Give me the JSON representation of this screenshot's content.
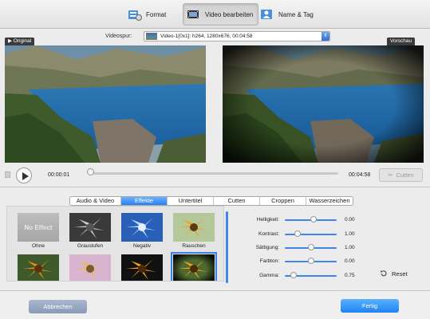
{
  "toolbar": {
    "tabs": [
      {
        "label": "Format",
        "icon": "format-icon",
        "active": false
      },
      {
        "label": "Video bearbeiten",
        "icon": "film-edit-icon",
        "active": true
      },
      {
        "label": "Name & Tag",
        "icon": "person-tag-icon",
        "active": false
      }
    ]
  },
  "track": {
    "label": "Videospur:",
    "value": "Video-1[0x1]: h264, 1280x676, 00:04:58"
  },
  "preview": {
    "original_tag": "Original",
    "preview_tag": "Vorschau"
  },
  "player": {
    "current_time": "00:00:01",
    "total_time": "00:04:58",
    "cut_label": "Cutten",
    "progress": 0.0
  },
  "tabs": {
    "items": [
      "Audio & Video",
      "Effekte",
      "Untertitel",
      "Cutten",
      "Croppen",
      "Wasserzeichen"
    ],
    "active": "Effekte"
  },
  "effects": [
    {
      "label": "Ohne",
      "thumb_text": "No Effect"
    },
    {
      "label": "Graustufen"
    },
    {
      "label": "Negativ"
    },
    {
      "label": "Rauschen"
    },
    {
      "label": ""
    },
    {
      "label": ""
    },
    {
      "label": ""
    },
    {
      "label": ""
    }
  ],
  "adjustments": [
    {
      "label": "Helligkeit:",
      "value": "0.00",
      "level": 0.55
    },
    {
      "label": "Kontrast:",
      "value": "1.00",
      "level": 0.25
    },
    {
      "label": "Sättigung:",
      "value": "1.00",
      "level": 0.5
    },
    {
      "label": "Farbton:",
      "value": "0.00",
      "level": 0.5
    },
    {
      "label": "Gamma:",
      "value": "0.75",
      "level": 0.15
    }
  ],
  "reset_label": "Reset",
  "footer": {
    "cancel_label": "Abbrechen",
    "done_label": "Fertig"
  },
  "colors": {
    "accent": "#2a80f0",
    "cancel": "#8899b8"
  }
}
